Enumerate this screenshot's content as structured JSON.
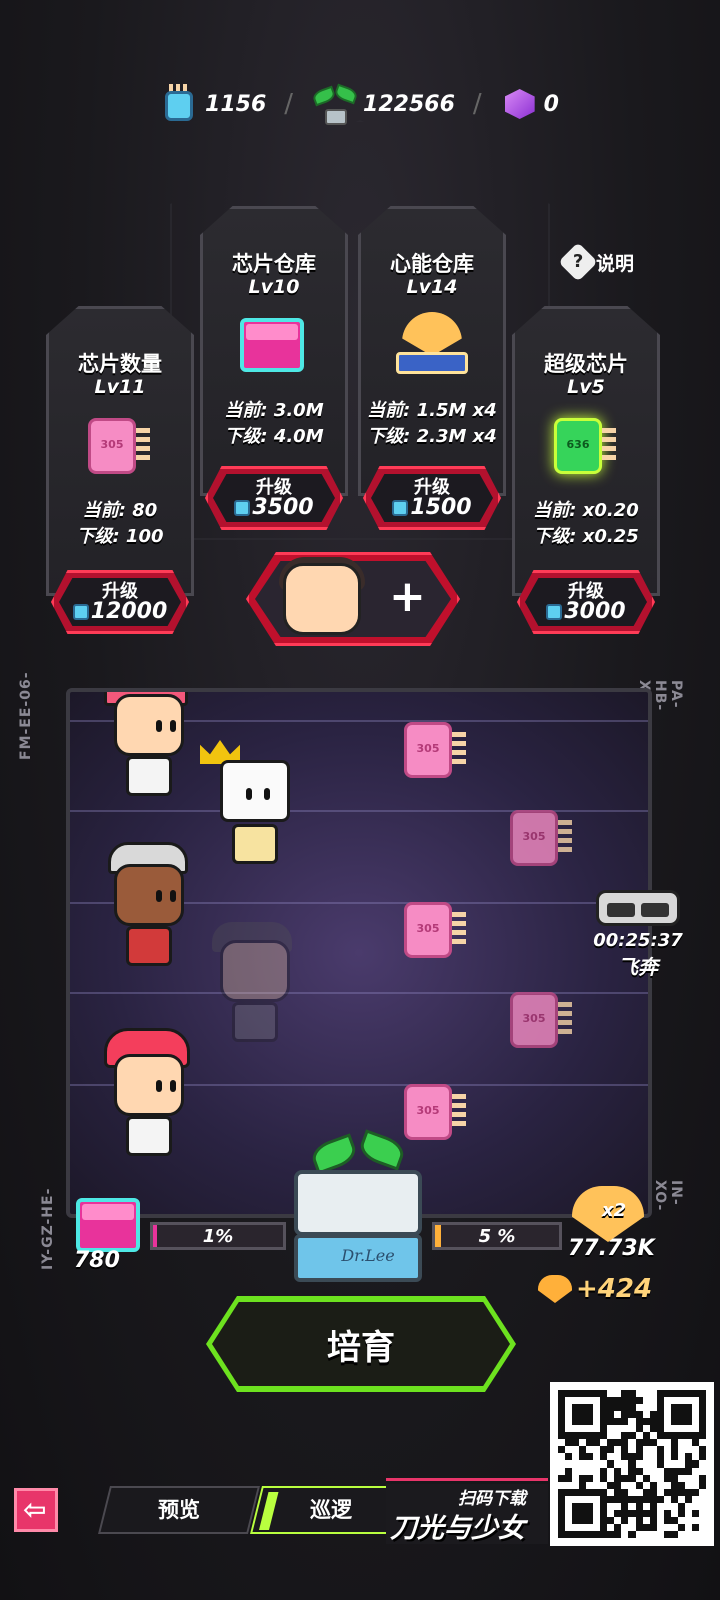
{
  "currency": [
    {
      "icon": "chip-icon",
      "value": "1156"
    },
    {
      "icon": "sprout-icon",
      "value": "122566"
    },
    {
      "icon": "cube-icon",
      "value": "0"
    }
  ],
  "explain_label": "说明",
  "cards": [
    {
      "name": "芯片数量",
      "level": "Lv11",
      "current": "当前: 80",
      "next": "下级: 100",
      "btn_label": "升级",
      "cost": "12000",
      "icon": "chip-icon",
      "chip_text": "305"
    },
    {
      "name": "芯片仓库",
      "level": "Lv10",
      "current": "当前: 3.0M",
      "next": "下级: 4.0M",
      "btn_label": "升级",
      "cost": "3500",
      "icon": "storage-box-icon"
    },
    {
      "name": "心能仓库",
      "level": "Lv14",
      "current": "当前: 1.5M x4",
      "next": "下级: 2.3M x4",
      "btn_label": "升级",
      "cost": "1500",
      "icon": "heart-storage-icon"
    },
    {
      "name": "超级芯片",
      "level": "Lv5",
      "current": "当前: x0.20",
      "next": "下级: x0.25",
      "btn_label": "升级",
      "cost": "3000",
      "icon": "super-chip-icon",
      "chip_text": "636"
    }
  ],
  "arena": {
    "side_codes": [
      "FM-EE-06-",
      "PA-HB-XY-",
      "IY-GZ-HE-",
      "IN-XO-XH-"
    ],
    "chip_text": "305"
  },
  "timer": {
    "time": "00:25:37",
    "label": "飞奔"
  },
  "progress": {
    "left_value": 780,
    "left_percent": "1%",
    "left_fill": 0.01,
    "right_percent": "5 %",
    "right_fill": 0.05,
    "machine_label": "Dr.Lee",
    "heart_multiplier": "x2",
    "heart_value": "77.73K",
    "gain": "+424"
  },
  "cultivate_label": "培育",
  "nav": {
    "back": "⇦",
    "tabs": [
      "预览",
      "巡逻"
    ],
    "promo_scan": "扫码下载",
    "promo_title": "刀光与少女"
  },
  "colors": {
    "accent_red": "#ff3b57",
    "accent_green": "#6de21f",
    "chip_pink": "#f68cc4"
  }
}
